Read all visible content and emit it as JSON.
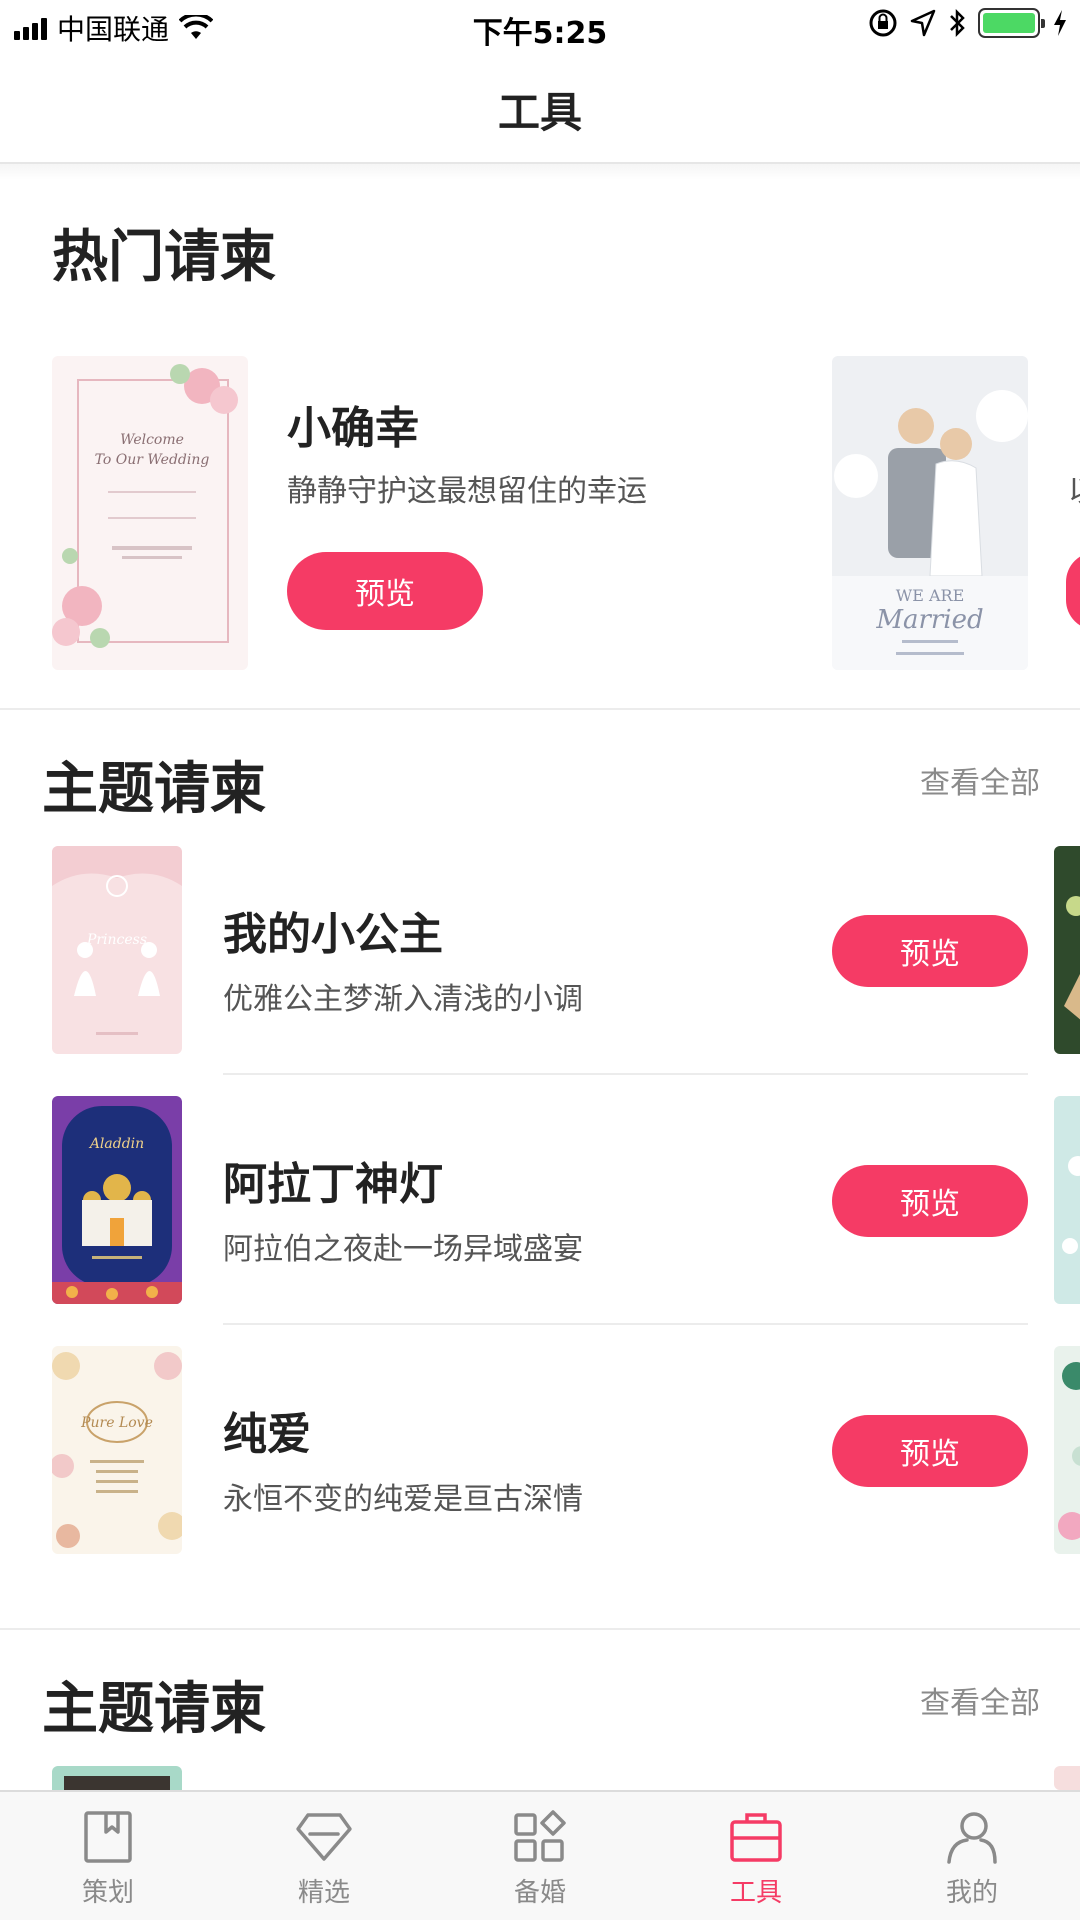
{
  "status_bar": {
    "carrier": "中国联通",
    "time": "下午5:25"
  },
  "nav": {
    "title": "工具"
  },
  "hot_section": {
    "title": "热门请柬",
    "cards": [
      {
        "name": "小确幸",
        "desc": "静静守护这最想留住的幸运",
        "button": "预览"
      }
    ],
    "peek_text": "以"
  },
  "theme_section_1": {
    "title": "主题请柬",
    "see_all": "查看全部",
    "items": [
      {
        "name": "我的小公主",
        "desc": "优雅公主梦渐入清浅的小调",
        "button": "预览"
      },
      {
        "name": "阿拉丁神灯",
        "desc": "阿拉伯之夜赴一场异域盛宴",
        "button": "预览"
      },
      {
        "name": "纯爱",
        "desc": "永恒不变的纯爱是亘古深情",
        "button": "预览"
      }
    ]
  },
  "theme_section_2": {
    "title": "主题请柬",
    "see_all": "查看全部"
  },
  "tab_bar": {
    "active": "工具",
    "accent_color": "#f53b65",
    "tabs": [
      {
        "label": "策划",
        "icon": "bookmark-icon"
      },
      {
        "label": "精选",
        "icon": "diamond-icon"
      },
      {
        "label": "备婚",
        "icon": "grid-icon"
      },
      {
        "label": "工具",
        "icon": "toolbox-icon"
      },
      {
        "label": "我的",
        "icon": "person-icon"
      }
    ]
  }
}
